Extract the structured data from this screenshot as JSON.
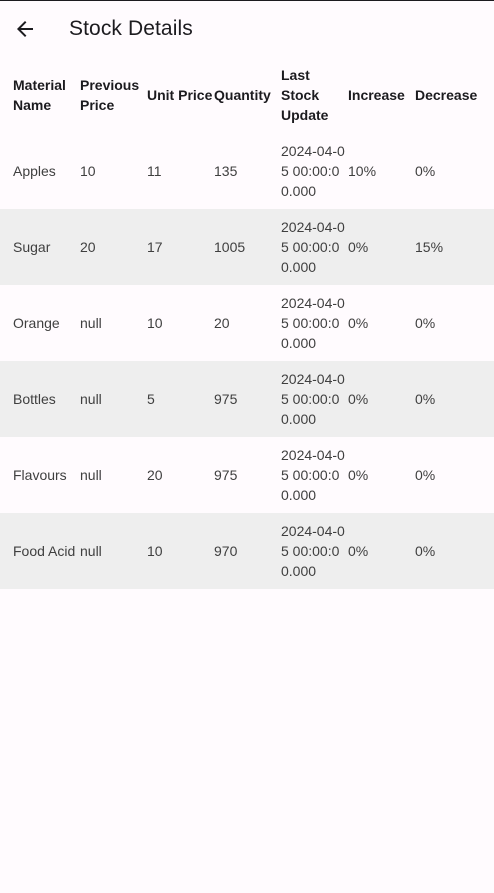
{
  "app_bar": {
    "title": "Stock Details",
    "back_icon": "arrow-back-icon"
  },
  "table": {
    "headers": [
      "Material Name",
      "Previous Price",
      "Unit Price",
      "Quantity",
      "Last Stock Update",
      "Increase",
      "Decrease"
    ],
    "rows": [
      [
        "Apples",
        "10",
        "11",
        "135",
        "2024-04-05 00:00:00.000",
        "10%",
        "0%"
      ],
      [
        "Sugar",
        "20",
        "17",
        "1005",
        "2024-04-05 00:00:00.000",
        "0%",
        "15%"
      ],
      [
        "Orange",
        "null",
        "10",
        "20",
        "2024-04-05 00:00:00.000",
        "0%",
        "0%"
      ],
      [
        "Bottles",
        "null",
        "5",
        "975",
        "2024-04-05 00:00:00.000",
        "0%",
        "0%"
      ],
      [
        "Flavours",
        "null",
        "20",
        "975",
        "2024-04-05 00:00:00.000",
        "0%",
        "0%"
      ],
      [
        "Food Acid",
        "null",
        "10",
        "970",
        "2024-04-05 00:00:00.000",
        "0%",
        "0%"
      ]
    ]
  },
  "colors": {
    "background": "#fffbfe",
    "striped_row": "#eeeeee",
    "text": "#1c1b1f",
    "cell_text": "#3f3f3f"
  }
}
